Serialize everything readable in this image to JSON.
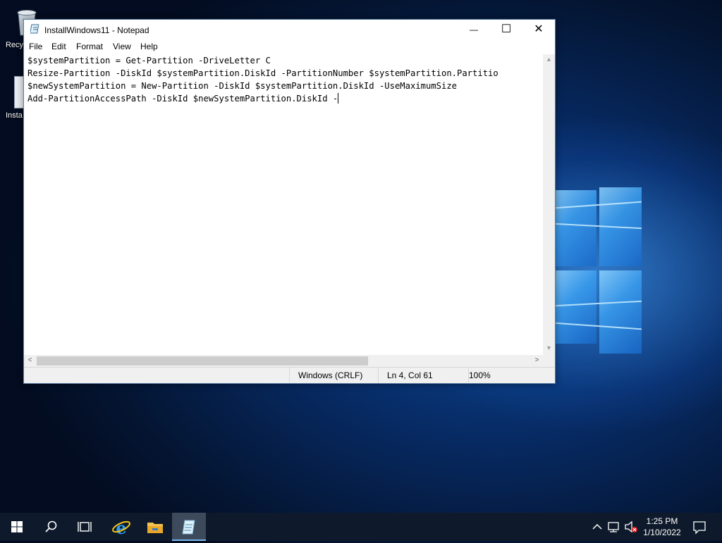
{
  "desktop": {
    "icons": [
      {
        "label": "Recy"
      },
      {
        "label": "Insta"
      }
    ]
  },
  "window": {
    "title": "InstallWindows11 - Notepad",
    "controls": {
      "minimize": "—",
      "maximize": "☐",
      "close": "✕"
    },
    "menu": [
      "File",
      "Edit",
      "Format",
      "View",
      "Help"
    ],
    "lines": [
      "$systemPartition = Get-Partition -DriveLetter C",
      "Resize-Partition -DiskId $systemPartition.DiskId -PartitionNumber $systemPartition.Partitio",
      "$newSystemPartition = New-Partition -DiskId $systemPartition.DiskId -UseMaximumSize",
      "Add-PartitionAccessPath -DiskId $newSystemPartition.DiskId -"
    ],
    "status": {
      "line_endings": "Windows (CRLF)",
      "position": "Ln 4, Col 61",
      "zoom": "100%"
    }
  },
  "taskbar": {
    "icons": [
      "windows-start-icon",
      "search-icon",
      "task-view-icon",
      "internet-explorer-icon",
      "file-explorer-icon",
      "notepad-icon"
    ],
    "tray_icons": [
      "chevron-up-icon",
      "network-icon",
      "volume-muted-icon",
      "notifications-icon"
    ],
    "time": "1:25 PM",
    "date": "1/10/2022"
  }
}
